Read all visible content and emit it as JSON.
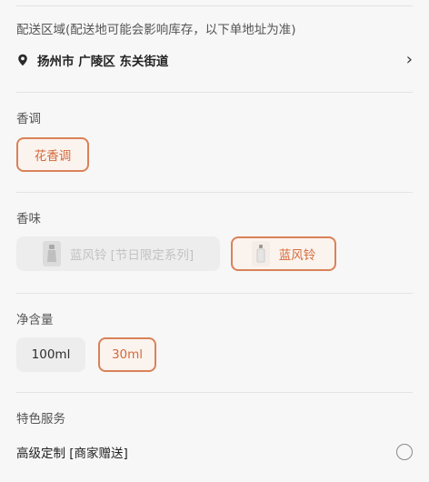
{
  "delivery": {
    "label": "配送区域(配送地可能会影响库存，以下单地址为准)",
    "address": "扬州市 广陵区 东关街道",
    "location_icon": "map-pin-icon",
    "chevron_icon": "chevron-right-icon"
  },
  "fragrance": {
    "title": "香调",
    "options": [
      {
        "label": "花香调",
        "selected": true
      }
    ]
  },
  "scent": {
    "title": "香味",
    "options": [
      {
        "label": "蓝风铃 [节日限定系列]",
        "selected": false,
        "disabled": true
      },
      {
        "label": "蓝风铃",
        "selected": true,
        "disabled": false
      }
    ]
  },
  "volume": {
    "title": "净含量",
    "options": [
      {
        "label": "100ml",
        "selected": false
      },
      {
        "label": "30ml",
        "selected": true
      }
    ]
  },
  "services": {
    "title": "特色服务",
    "items": [
      {
        "label": "高级定制 [商家赠送]",
        "checked": false
      }
    ]
  },
  "colors": {
    "accent": "#d36a3a",
    "accent_border": "#d98258",
    "chip_bg": "#ededed",
    "page_bg": "#f7f7f7"
  }
}
